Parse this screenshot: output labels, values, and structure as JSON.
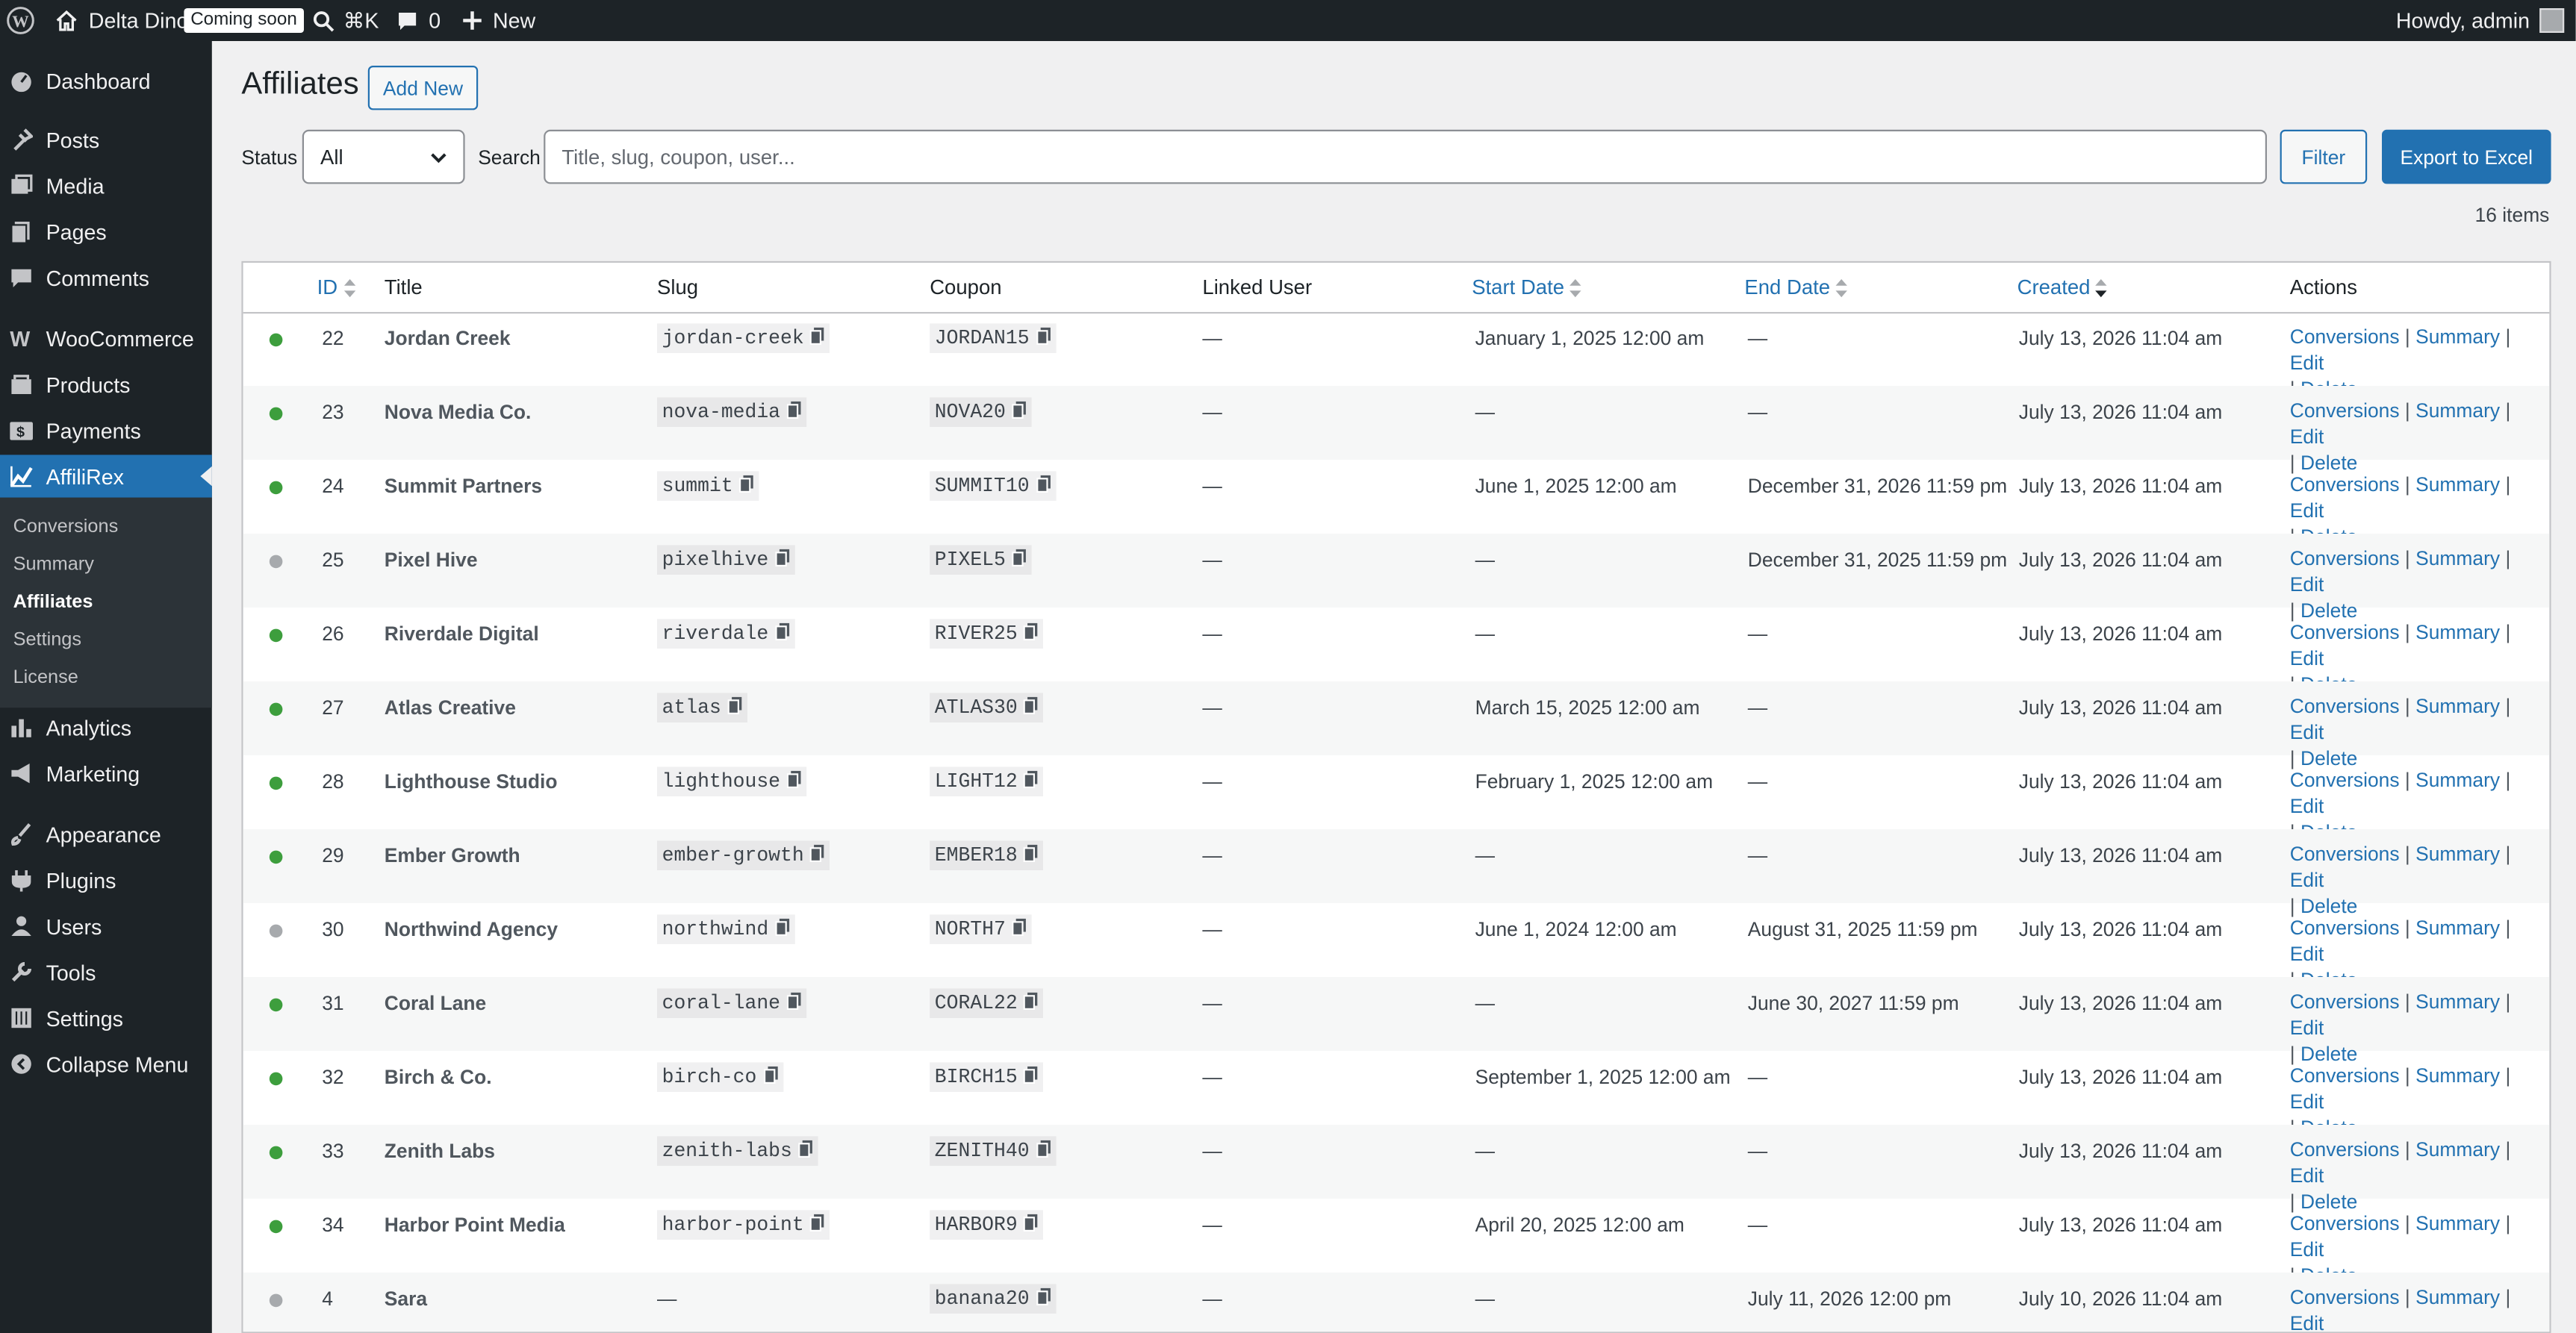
{
  "adminbar": {
    "site_name": "Delta Dino",
    "badge": "Coming soon",
    "shortcut": "⌘K",
    "comments_count": "0",
    "new_label": "New",
    "howdy": "Howdy, admin"
  },
  "sidebar": {
    "items": [
      {
        "label": "Dashboard",
        "icon": "dashboard-icon"
      },
      {
        "label": "Posts",
        "icon": "pin-icon"
      },
      {
        "label": "Media",
        "icon": "media-icon"
      },
      {
        "label": "Pages",
        "icon": "pages-icon"
      },
      {
        "label": "Comments",
        "icon": "comment-icon"
      },
      {
        "label": "WooCommerce",
        "icon": "woo-icon"
      },
      {
        "label": "Products",
        "icon": "products-icon"
      },
      {
        "label": "Payments",
        "icon": "payments-icon"
      },
      {
        "label": "AffiliRex",
        "icon": "chart-icon"
      },
      {
        "label": "Analytics",
        "icon": "analytics-icon"
      },
      {
        "label": "Marketing",
        "icon": "megaphone-icon"
      },
      {
        "label": "Appearance",
        "icon": "brush-icon"
      },
      {
        "label": "Plugins",
        "icon": "plugin-icon"
      },
      {
        "label": "Users",
        "icon": "user-icon"
      },
      {
        "label": "Tools",
        "icon": "wrench-icon"
      },
      {
        "label": "Settings",
        "icon": "settings-icon"
      },
      {
        "label": "Collapse Menu",
        "icon": "collapse-icon"
      }
    ],
    "submenu": [
      "Conversions",
      "Summary",
      "Affiliates",
      "Settings",
      "License"
    ]
  },
  "page": {
    "title": "Affiliates",
    "add_new": "Add New",
    "status_label": "Status",
    "status_value": "All",
    "search_label": "Search",
    "search_placeholder": "Title, slug, coupon, user...",
    "filter": "Filter",
    "export": "Export to Excel",
    "items_count": "16 items"
  },
  "table": {
    "headers": {
      "id": "ID",
      "title": "Title",
      "slug": "Slug",
      "coupon": "Coupon",
      "linked_user": "Linked User",
      "start_date": "Start Date",
      "end_date": "End Date",
      "created": "Created",
      "actions": "Actions"
    },
    "action_labels": {
      "conversions": "Conversions",
      "summary": "Summary",
      "edit": "Edit",
      "delete": "Delete",
      "sep": "|"
    },
    "status_colors": {
      "active": "#3d9e3d",
      "inactive": "#a7aaad"
    },
    "rows": [
      {
        "status": "active",
        "id": "22",
        "title": "Jordan Creek",
        "slug": "jordan-creek",
        "coupon": "JORDAN15",
        "user": "—",
        "start": "January 1, 2025 12:00 am",
        "end": "—",
        "created": "July 13, 2026 11:04 am"
      },
      {
        "status": "active",
        "id": "23",
        "title": "Nova Media Co.",
        "slug": "nova-media",
        "coupon": "NOVA20",
        "user": "—",
        "start": "—",
        "end": "—",
        "created": "July 13, 2026 11:04 am"
      },
      {
        "status": "active",
        "id": "24",
        "title": "Summit Partners",
        "slug": "summit",
        "coupon": "SUMMIT10",
        "user": "—",
        "start": "June 1, 2025 12:00 am",
        "end": "December 31, 2026 11:59 pm",
        "created": "July 13, 2026 11:04 am"
      },
      {
        "status": "inactive",
        "id": "25",
        "title": "Pixel Hive",
        "slug": "pixelhive",
        "coupon": "PIXEL5",
        "user": "—",
        "start": "—",
        "end": "December 31, 2025 11:59 pm",
        "created": "July 13, 2026 11:04 am"
      },
      {
        "status": "active",
        "id": "26",
        "title": "Riverdale Digital",
        "slug": "riverdale",
        "coupon": "RIVER25",
        "user": "—",
        "start": "—",
        "end": "—",
        "created": "July 13, 2026 11:04 am"
      },
      {
        "status": "active",
        "id": "27",
        "title": "Atlas Creative",
        "slug": "atlas",
        "coupon": "ATLAS30",
        "user": "—",
        "start": "March 15, 2025 12:00 am",
        "end": "—",
        "created": "July 13, 2026 11:04 am"
      },
      {
        "status": "active",
        "id": "28",
        "title": "Lighthouse Studio",
        "slug": "lighthouse",
        "coupon": "LIGHT12",
        "user": "—",
        "start": "February 1, 2025 12:00 am",
        "end": "—",
        "created": "July 13, 2026 11:04 am"
      },
      {
        "status": "active",
        "id": "29",
        "title": "Ember Growth",
        "slug": "ember-growth",
        "coupon": "EMBER18",
        "user": "—",
        "start": "—",
        "end": "—",
        "created": "July 13, 2026 11:04 am"
      },
      {
        "status": "inactive",
        "id": "30",
        "title": "Northwind Agency",
        "slug": "northwind",
        "coupon": "NORTH7",
        "user": "—",
        "start": "June 1, 2024 12:00 am",
        "end": "August 31, 2025 11:59 pm",
        "created": "July 13, 2026 11:04 am"
      },
      {
        "status": "active",
        "id": "31",
        "title": "Coral Lane",
        "slug": "coral-lane",
        "coupon": "CORAL22",
        "user": "—",
        "start": "—",
        "end": "June 30, 2027 11:59 pm",
        "created": "July 13, 2026 11:04 am"
      },
      {
        "status": "active",
        "id": "32",
        "title": "Birch & Co.",
        "slug": "birch-co",
        "coupon": "BIRCH15",
        "user": "—",
        "start": "September 1, 2025 12:00 am",
        "end": "—",
        "created": "July 13, 2026 11:04 am"
      },
      {
        "status": "active",
        "id": "33",
        "title": "Zenith Labs",
        "slug": "zenith-labs",
        "coupon": "ZENITH40",
        "user": "—",
        "start": "—",
        "end": "—",
        "created": "July 13, 2026 11:04 am"
      },
      {
        "status": "active",
        "id": "34",
        "title": "Harbor Point Media",
        "slug": "harbor-point",
        "coupon": "HARBOR9",
        "user": "—",
        "start": "April 20, 2025 12:00 am",
        "end": "—",
        "created": "July 13, 2026 11:04 am"
      },
      {
        "status": "inactive",
        "id": "4",
        "title": "Sara",
        "slug": "—",
        "coupon": "banana20",
        "user": "—",
        "start": "—",
        "end": "July 11, 2026 12:00 pm",
        "created": "July 10, 2026 11:04 am"
      }
    ]
  }
}
